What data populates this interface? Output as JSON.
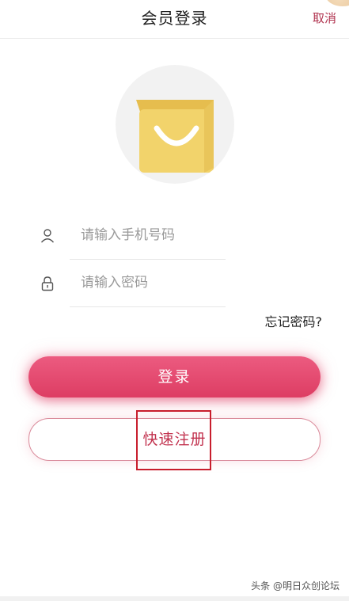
{
  "header": {
    "title": "会员登录",
    "cancel_label": "取消"
  },
  "logo": {
    "icon": "shopping-bag-icon",
    "colors": {
      "circle": "#f2f2f2",
      "bag": "#f2d36b",
      "bag_top": "#e6bd4e",
      "handle": "#ffffff"
    }
  },
  "form": {
    "phone": {
      "icon": "user-icon",
      "placeholder": "请输入手机号码",
      "value": ""
    },
    "password": {
      "icon": "lock-icon",
      "placeholder": "请输入密码",
      "value": ""
    },
    "forgot_label": "忘记密码?"
  },
  "buttons": {
    "login_label": "登录",
    "register_label": "快速注册"
  },
  "watermark": {
    "text": "头条 @明日众创论坛"
  },
  "colors": {
    "accent": "#dd3d63",
    "accent_light": "#ec5b80",
    "cancel": "#b0324e",
    "highlight": "#c81e2d"
  }
}
